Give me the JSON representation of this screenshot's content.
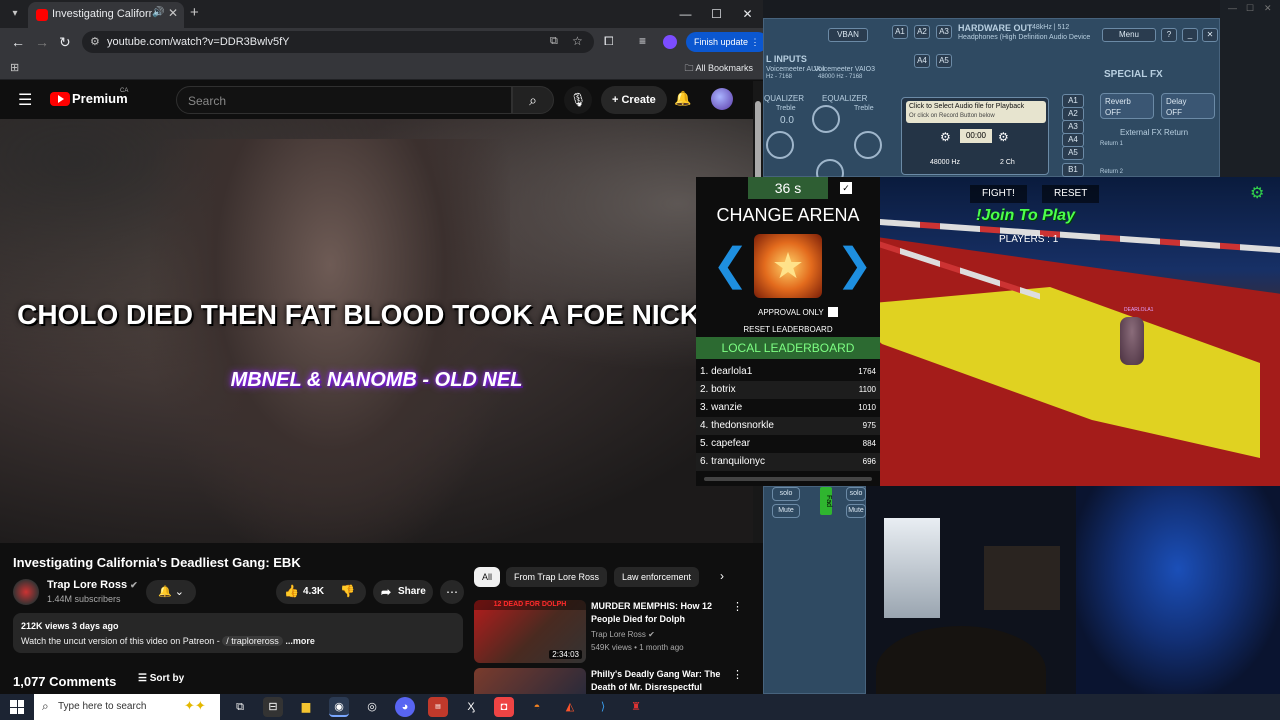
{
  "browser": {
    "tab_title": "Investigating California's Dea",
    "url": "youtube.com/watch?v=DDR3Bwlv5fY",
    "finish_update": "Finish update",
    "all_bookmarks": "All Bookmarks"
  },
  "youtube": {
    "brand": "Premium",
    "brand_region": "CA",
    "search_placeholder": "Search",
    "create_label": "Create",
    "video_overlay_title": "CHOLO DIED THEN FAT BLOOD TOOK A FOE NICKEL",
    "video_overlay_subtitle": "MBNEL & NANOMB - OLD NEL",
    "video_title": "Investigating California's Deadliest Gang: EBK",
    "channel_name": "Trap Lore Ross",
    "channel_subs": "1.44M subscribers",
    "likes": "4.3K",
    "share_label": "Share",
    "desc_meta": "212K views  3 days ago",
    "desc_text": "Watch the uncut version of this video on Patreon - ",
    "desc_link": "/ traploreross",
    "desc_more": "...more",
    "comments_count": "1,077 Comments",
    "sort_by": "Sort by",
    "chips": [
      "All",
      "From Trap Lore Ross",
      "Law enforcement"
    ],
    "recs": [
      {
        "banner": "12 DEAD FOR DOLPH",
        "duration": "2:34:03",
        "title": "MURDER MEMPHIS: How 12 People Died for Dolph",
        "channel": "Trap Lore Ross",
        "meta": "549K views • 1 month ago"
      },
      {
        "banner": "",
        "duration": "",
        "title": "Philly's Deadly Gang War: The Death of Mr. Disrespectful",
        "channel": "",
        "meta": ""
      }
    ]
  },
  "voicemeeter": {
    "vban": "VBAN",
    "a1": "A1",
    "a2": "A2",
    "a3": "A3",
    "a4": "A4",
    "a5": "A5",
    "hw_out": "HARDWARE OUT",
    "hw_rate": "48kHz | 512",
    "hw_device": "Headphones (High Definition Audio Device",
    "menu": "Menu",
    "help": "?",
    "inputs": "L INPUTS",
    "aux": "Voicemeeter AUX I",
    "vaio3": "Voicemeeter VAIO3",
    "rate_left": "Hz - 7168",
    "rate_right": "48000 Hz - 7168",
    "special_fx": "SPECIAL FX",
    "equalizer1": "QUALIZER",
    "equalizer2": "EQUALIZER",
    "treble1": "Treble",
    "treble2": "Treble",
    "zero": "0.0",
    "tape_line1": "Click to Select Audio file for Playback",
    "tape_line2": "Or click on Record Button below",
    "tape_time": "00:00",
    "tape_rate": "48000 Hz",
    "tape_ch": "2 Ch",
    "reverb": "Reverb",
    "reverb_state": "OFF",
    "delay": "Delay",
    "delay_state": "OFF",
    "ext_fx": "External FX Return",
    "return1": "Return 1",
    "return2": "Return 2",
    "route_a1": "A1",
    "route_a2": "A2",
    "route_a3": "A3",
    "route_a4": "A4",
    "route_a5": "A5",
    "route_b1": "B1",
    "solo": "solo",
    "mute": "Mute",
    "fader": "Fad"
  },
  "game": {
    "timer": "36 s",
    "check": "✓",
    "change_arena": "CHANGE ARENA",
    "approval_only": "APPROVAL ONLY",
    "reset_leaderboard": "RESET LEADERBOARD",
    "local_leaderboard": "LOCAL LEADERBOARD",
    "leaderboard": [
      {
        "name": "1. dearlola1",
        "score": "1764"
      },
      {
        "name": "2. botrix",
        "score": "1100"
      },
      {
        "name": "3. wanzie",
        "score": "1010"
      },
      {
        "name": "4. thedonsnorkle",
        "score": "975"
      },
      {
        "name": "5. capefear",
        "score": "884"
      },
      {
        "name": "6. tranquilonyc",
        "score": "696"
      }
    ],
    "fight": "FIGHT!",
    "reset": "RESET",
    "join": "!Join To Play",
    "players": "PLAYERS : 1",
    "player_tag": "DEARLOLA1"
  },
  "taskbar": {
    "search_placeholder": "Type here to search"
  }
}
